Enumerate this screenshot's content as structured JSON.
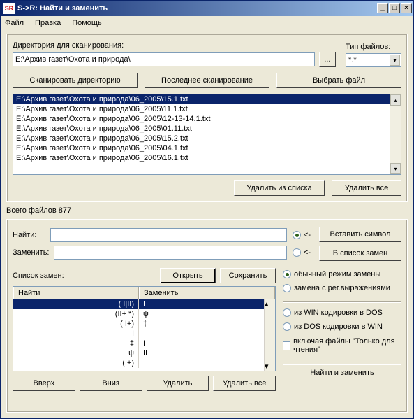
{
  "window": {
    "title": "S->R: Найти и заменить"
  },
  "menu": {
    "file": "Файл",
    "edit": "Правка",
    "help": "Помощь"
  },
  "scan": {
    "dir_label": "Директория для сканирования:",
    "dir_value": "E:\\Архив газет\\Охота и природа\\",
    "filetype_label": "Тип файлов:",
    "filetype_value": "*.*",
    "browse_btn": "...",
    "scan_btn": "Сканировать директорию",
    "last_scan_btn": "Последнее сканирование",
    "choose_file_btn": "Выбрать файл",
    "delete_from_list_btn": "Удалить из списка",
    "delete_all_btn": "Удалить все",
    "files": [
      "E:\\Архив газет\\Охота и природа\\06_2005\\15.1.txt",
      "E:\\Архив газет\\Охота и природа\\06_2005\\11.1.txt",
      "E:\\Архив газет\\Охота и природа\\06_2005\\12-13-14.1.txt",
      "E:\\Архив газет\\Охота и природа\\06_2005\\01.11.txt",
      "E:\\Архив газет\\Охота и природа\\06_2005\\15.2.txt",
      "E:\\Архив газет\\Охота и природа\\06_2005\\04.1.txt",
      "E:\\Архив газет\\Охота и природа\\06_2005\\16.1.txt"
    ]
  },
  "status": {
    "total_files": "Всего файлов 877"
  },
  "replace": {
    "find_label": "Найти:",
    "replace_label": "Заменить:",
    "find_value": "",
    "replace_value": "",
    "radio_arrow": "<-",
    "insert_symbol_btn": "Вставить символ",
    "to_list_btn": "В список замен",
    "list_label": "Список замен:",
    "open_btn": "Открыть",
    "save_btn": "Сохранить",
    "col_find": "Найти",
    "col_replace": "Заменить",
    "rows": [
      {
        "find": "( І|ІІ)",
        "replace": "І"
      },
      {
        "find": "(ІІ+ *)",
        "replace": "ψ"
      },
      {
        "find": "( І+)",
        "replace": "‡"
      },
      {
        "find": "І",
        "replace": ""
      },
      {
        "find": "‡",
        "replace": "І"
      },
      {
        "find": "ψ",
        "replace": "ІІ"
      },
      {
        "find": "( +)",
        "replace": ""
      }
    ],
    "up_btn": "Вверх",
    "down_btn": "Вниз",
    "delete_btn": "Удалить",
    "delete_all_btn": "Удалить все",
    "mode_normal": "обычный режим замены",
    "mode_regex": "замена с рег.выражениями",
    "enc_win_dos": "из WIN кодировки в DOS",
    "enc_dos_win": "из DOS кодировки в WIN",
    "readonly_label": "включая файлы \"Только для чтения\"",
    "find_replace_btn": "Найти и заменить"
  }
}
